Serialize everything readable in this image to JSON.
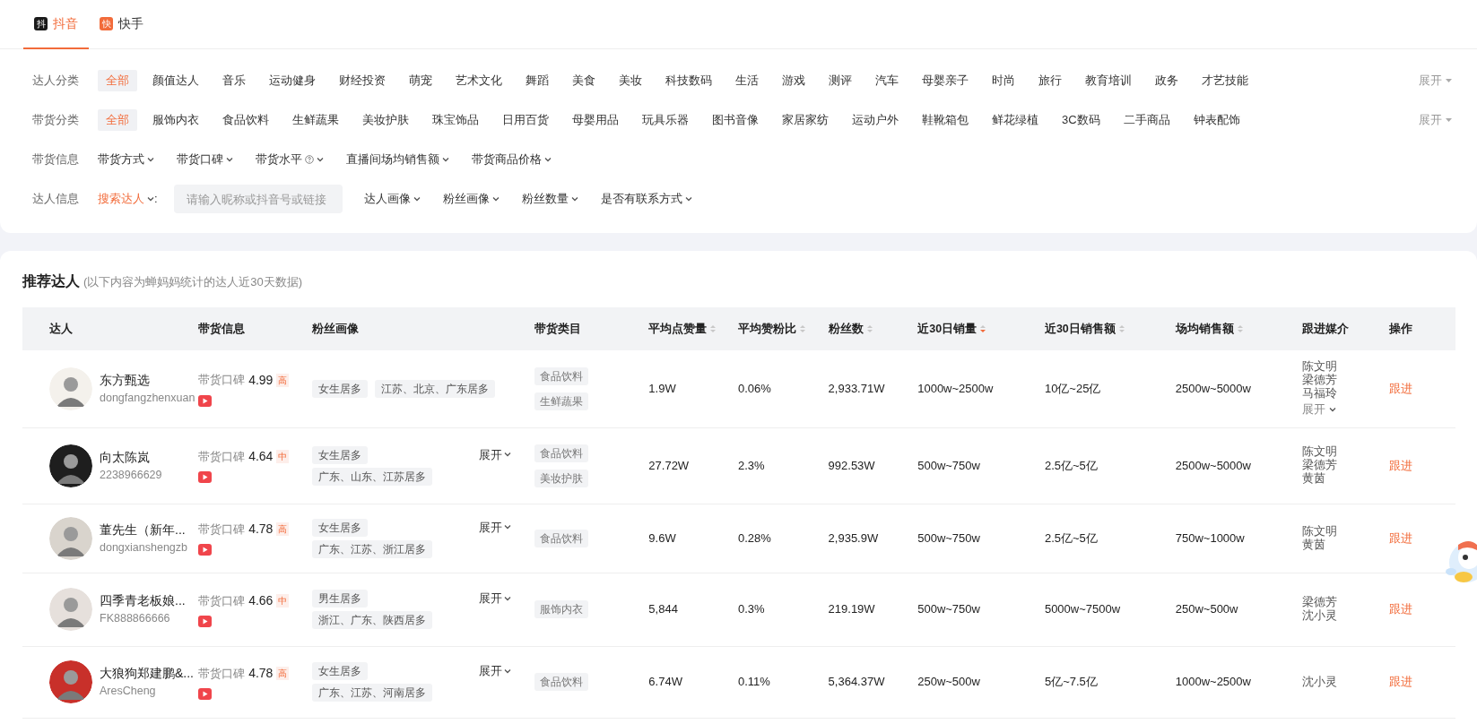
{
  "platform_tabs": [
    {
      "badge": "抖",
      "label": "抖音",
      "selected": true,
      "color": "#1a1a1a"
    },
    {
      "badge": "快",
      "label": "快手",
      "selected": false,
      "color": "#f26b3a"
    }
  ],
  "filters": [
    {
      "kind": "chips",
      "label": "达人分类",
      "expand": "展开",
      "options": [
        {
          "label": "全部",
          "selected": true
        },
        {
          "label": "颜值达人",
          "selected": false
        },
        {
          "label": "音乐",
          "selected": false
        },
        {
          "label": "运动健身",
          "selected": false
        },
        {
          "label": "财经投资",
          "selected": false
        },
        {
          "label": "萌宠",
          "selected": false
        },
        {
          "label": "艺术文化",
          "selected": false
        },
        {
          "label": "舞蹈",
          "selected": false
        },
        {
          "label": "美食",
          "selected": false
        },
        {
          "label": "美妆",
          "selected": false
        },
        {
          "label": "科技数码",
          "selected": false
        },
        {
          "label": "生活",
          "selected": false
        },
        {
          "label": "游戏",
          "selected": false
        },
        {
          "label": "测评",
          "selected": false
        },
        {
          "label": "汽车",
          "selected": false
        },
        {
          "label": "母婴亲子",
          "selected": false
        },
        {
          "label": "时尚",
          "selected": false
        },
        {
          "label": "旅行",
          "selected": false
        },
        {
          "label": "教育培训",
          "selected": false
        },
        {
          "label": "政务",
          "selected": false
        },
        {
          "label": "才艺技能",
          "selected": false
        }
      ]
    },
    {
      "kind": "chips",
      "label": "带货分类",
      "expand": "展开",
      "options": [
        {
          "label": "全部",
          "selected": true
        },
        {
          "label": "服饰内衣",
          "selected": false
        },
        {
          "label": "食品饮料",
          "selected": false
        },
        {
          "label": "生鲜蔬果",
          "selected": false
        },
        {
          "label": "美妆护肤",
          "selected": false
        },
        {
          "label": "珠宝饰品",
          "selected": false
        },
        {
          "label": "日用百货",
          "selected": false
        },
        {
          "label": "母婴用品",
          "selected": false
        },
        {
          "label": "玩具乐器",
          "selected": false
        },
        {
          "label": "图书音像",
          "selected": false
        },
        {
          "label": "家居家纺",
          "selected": false
        },
        {
          "label": "运动户外",
          "selected": false
        },
        {
          "label": "鞋靴箱包",
          "selected": false
        },
        {
          "label": "鲜花绿植",
          "selected": false
        },
        {
          "label": "3C数码",
          "selected": false
        },
        {
          "label": "二手商品",
          "selected": false
        },
        {
          "label": "钟表配饰",
          "selected": false
        }
      ]
    },
    {
      "kind": "dropdowns",
      "label": "带货信息",
      "dropdowns": [
        {
          "label": "带货方式",
          "help": false
        },
        {
          "label": "带货口碑",
          "help": false
        },
        {
          "label": "带货水平",
          "help": true
        },
        {
          "label": "直播间场均销售额",
          "help": false
        },
        {
          "label": "带货商品价格",
          "help": false
        }
      ]
    },
    {
      "kind": "search",
      "label": "达人信息",
      "search_label": "搜索达人",
      "colon": ":",
      "placeholder": "请输入昵称或抖音号或链接",
      "dropdowns": [
        {
          "label": "达人画像",
          "help": false
        },
        {
          "label": "粉丝画像",
          "help": false
        },
        {
          "label": "粉丝数量",
          "help": false
        },
        {
          "label": "是否有联系方式",
          "help": false
        }
      ]
    }
  ],
  "table": {
    "title": "推荐达人",
    "subtitle": "(以下内容为蝉妈妈统计的达人近30天数据)",
    "columns": [
      {
        "label": "达人",
        "sortable": false
      },
      {
        "label": "带货信息",
        "sortable": false
      },
      {
        "label": "粉丝画像",
        "sortable": false
      },
      {
        "label": "带货类目",
        "sortable": false
      },
      {
        "label": "平均点赞量",
        "sortable": true,
        "sort_active": false
      },
      {
        "label": "平均赞粉比",
        "sortable": true,
        "sort_active": false
      },
      {
        "label": "粉丝数",
        "sortable": true,
        "sort_active": false
      },
      {
        "label": "近30日销量",
        "sortable": true,
        "sort_active": true
      },
      {
        "label": "近30日销售额",
        "sortable": true,
        "sort_active": false
      },
      {
        "label": "场均销售额",
        "sortable": true,
        "sort_active": false
      },
      {
        "label": "跟进媒介",
        "sortable": false
      },
      {
        "label": "操作",
        "sortable": false
      }
    ],
    "rows": [
      {
        "name": "东方甄选",
        "account": "dongfangzhenxuan",
        "rating_label": "带货口碑",
        "rating": "4.99",
        "rating_level": "高",
        "fan_tags": [
          "女生居多",
          "江苏、北京、广东居多"
        ],
        "categories": [
          "食品饮料",
          "生鲜蔬果"
        ],
        "avg_likes": "1.9W",
        "like_ratio": "0.06%",
        "fans": "2,933.71W",
        "sales_30d": "1000w~2500w",
        "revenue_30d": "10亿~25亿",
        "avg_revenue": "2500w~5000w",
        "media": [
          "陈文明",
          "梁德芳",
          "马福玲"
        ],
        "media_expand": "展开",
        "action": "跟进"
      },
      {
        "name": "向太陈岚",
        "account": "2238966629",
        "rating_label": "带货口碑",
        "rating": "4.64",
        "rating_level": "中",
        "fan_tags": [
          "女生居多",
          "广东、山东、江苏居多"
        ],
        "fan_expand": "展开",
        "categories": [
          "食品饮料",
          "美妆护肤"
        ],
        "avg_likes": "27.72W",
        "like_ratio": "2.3%",
        "fans": "992.53W",
        "sales_30d": "500w~750w",
        "revenue_30d": "2.5亿~5亿",
        "avg_revenue": "2500w~5000w",
        "media": [
          "陈文明",
          "梁德芳",
          "黄茵"
        ],
        "action": "跟进"
      },
      {
        "name": "董先生（新年...",
        "account": "dongxianshengzb",
        "rating_label": "带货口碑",
        "rating": "4.78",
        "rating_level": "高",
        "fan_tags": [
          "女生居多",
          "广东、江苏、浙江居多"
        ],
        "fan_expand": "展开",
        "categories": [
          "食品饮料"
        ],
        "avg_likes": "9.6W",
        "like_ratio": "0.28%",
        "fans": "2,935.9W",
        "sales_30d": "500w~750w",
        "revenue_30d": "2.5亿~5亿",
        "avg_revenue": "750w~1000w",
        "media": [
          "陈文明",
          "黄茵"
        ],
        "action": "跟进"
      },
      {
        "name": "四季青老板娘...",
        "account": "FK888866666",
        "rating_label": "带货口碑",
        "rating": "4.66",
        "rating_level": "中",
        "fan_tags": [
          "男生居多",
          "浙江、广东、陕西居多"
        ],
        "fan_expand": "展开",
        "categories": [
          "服饰内衣"
        ],
        "avg_likes": "5,844",
        "like_ratio": "0.3%",
        "fans": "219.19W",
        "sales_30d": "500w~750w",
        "revenue_30d": "5000w~7500w",
        "avg_revenue": "250w~500w",
        "media": [
          "梁德芳",
          "沈小灵"
        ],
        "action": "跟进"
      },
      {
        "name": "大狼狗郑建鹏&...",
        "account": "AresCheng",
        "rating_label": "带货口碑",
        "rating": "4.78",
        "rating_level": "高",
        "fan_tags": [
          "女生居多",
          "广东、江苏、河南居多"
        ],
        "fan_expand": "展开",
        "categories": [
          "食品饮料"
        ],
        "avg_likes": "6.74W",
        "like_ratio": "0.11%",
        "fans": "5,364.37W",
        "sales_30d": "250w~500w",
        "revenue_30d": "5亿~7.5亿",
        "avg_revenue": "1000w~2500w",
        "media": [
          "沈小灵"
        ],
        "action": "跟进"
      }
    ]
  }
}
